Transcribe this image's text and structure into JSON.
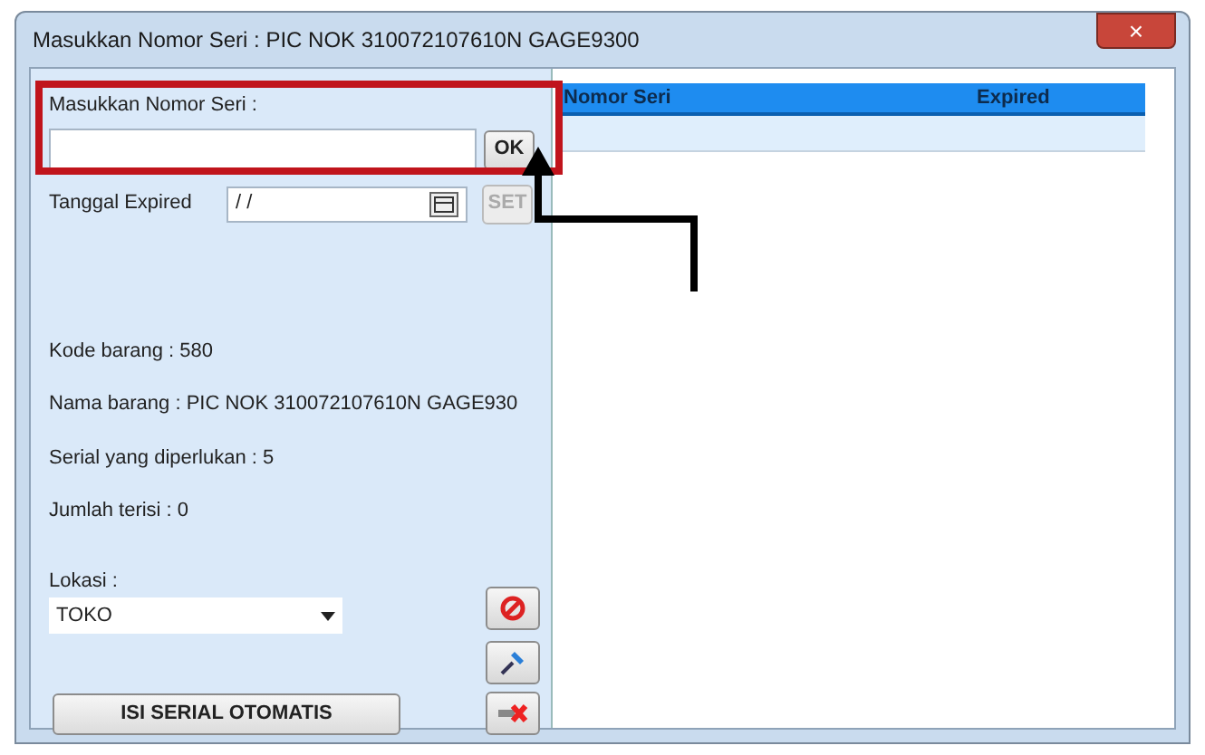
{
  "window": {
    "title": "Masukkan Nomor Seri : PIC NOK 310072107610N GAGE9300",
    "close": "×"
  },
  "serial": {
    "label": "Masukkan Nomor Seri :",
    "button": "OK"
  },
  "expiry": {
    "label": "Tanggal Expired",
    "value": "/ /",
    "button": "SET",
    "button_disabled": true
  },
  "info": [
    "Kode barang : 580",
    "Nama barang : PIC NOK 310072107610N GAGE930",
    "Serial yang diperlukan : 5",
    "Jumlah terisi : 0"
  ],
  "location": {
    "label": "Lokasi :",
    "value": "TOKO"
  },
  "auto_button": "ISI SERIAL OTOMATIS",
  "grid": {
    "columns": [
      "Nomor Seri",
      "Expired"
    ]
  }
}
